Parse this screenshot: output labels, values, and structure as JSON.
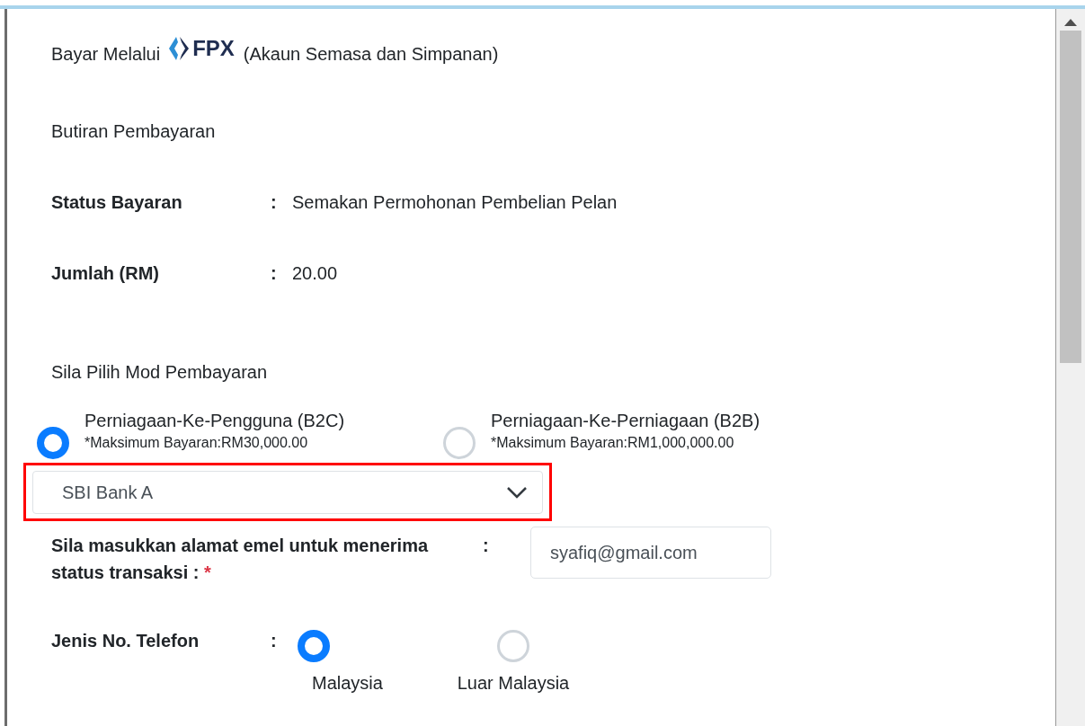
{
  "header": {
    "prefix": "Bayar Melalui",
    "logo_text": "FPX",
    "suffix": "(Akaun Semasa dan Simpanan)"
  },
  "section_title": "Butiran Pembayaran",
  "details": [
    {
      "label": "Status Bayaran",
      "colon": ":",
      "value": "Semakan Permohonan Pembelian Pelan"
    },
    {
      "label": "Jumlah (RM)",
      "colon": ":",
      "value": "20.00"
    }
  ],
  "mode_title": "Sila Pilih Mod Pembayaran",
  "modes": [
    {
      "label": "Perniagaan-Ke-Pengguna (B2C)",
      "note": "*Maksimum Bayaran:RM30,000.00",
      "selected": true
    },
    {
      "label": "Perniagaan-Ke-Perniagaan (B2B)",
      "note": "*Maksimum Bayaran:RM1,000,000.00",
      "selected": false
    }
  ],
  "bank_select": {
    "value": "SBI Bank A",
    "highlighted": true
  },
  "email": {
    "label": "Sila masukkan alamat emel untuk menerima status transaksi :",
    "required_mark": "*",
    "colon": ":",
    "value": "syafiq@gmail.com"
  },
  "phone": {
    "label": "Jenis No. Telefon",
    "colon": ":",
    "options": [
      {
        "label": "Malaysia",
        "selected": true
      },
      {
        "label": "Luar Malaysia",
        "selected": false
      }
    ]
  }
}
